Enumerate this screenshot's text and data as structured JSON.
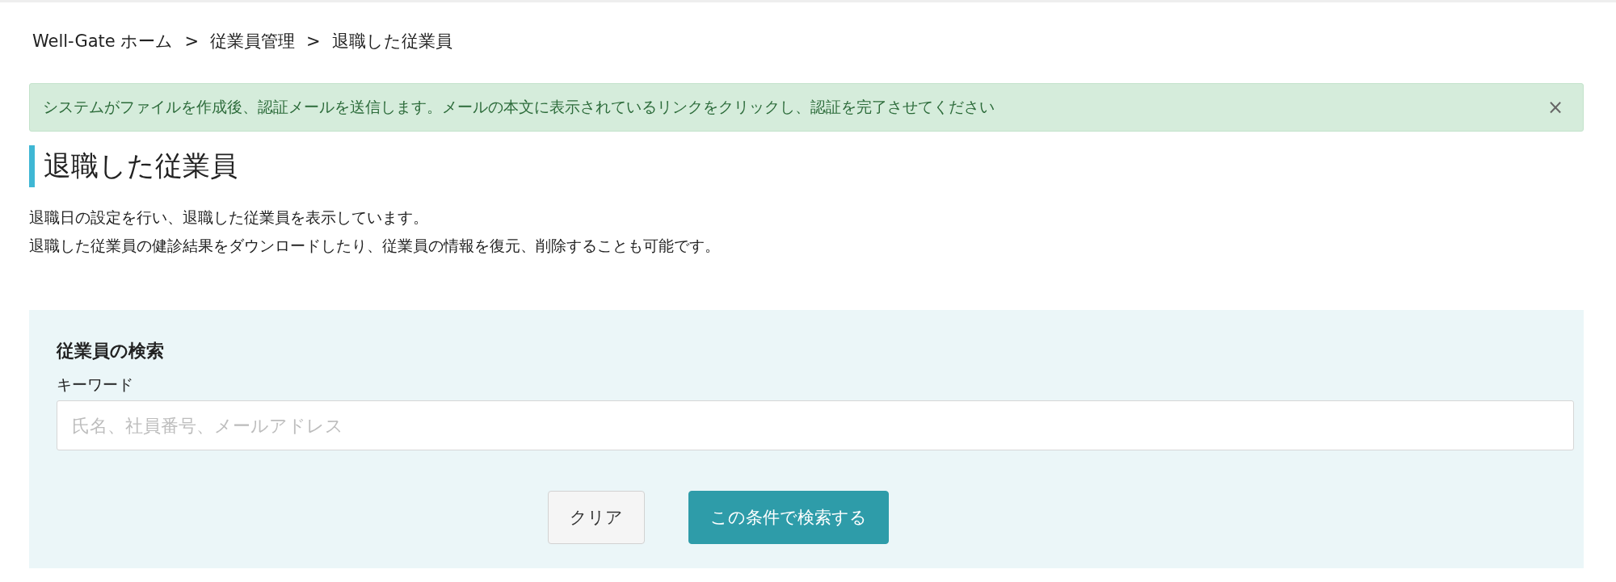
{
  "breadcrumb": [
    {
      "label": "Well-Gate ホーム",
      "separator": ">"
    },
    {
      "label": "従業員管理",
      "separator": ">"
    },
    {
      "label": "退職した従業員"
    }
  ],
  "alert": {
    "message": "システムがファイルを作成後、認証メールを送信します。メールの本文に表示されているリンクをクリックし、認証を完了させてください",
    "close": "×"
  },
  "page_title": "退職した従業員",
  "description": [
    "退職日の設定を行い、退職した従業員を表示しています。",
    "退職した従業員の健診結果をダウンロードしたり、従業員の情報を復元、削除することも可能です。"
  ],
  "search_panel": {
    "heading": "従業員の検索",
    "field_label": "キーワード",
    "placeholder": "氏名、社員番号、メールアドレス",
    "buttons": [
      {
        "kind": "secondary",
        "label": "クリア"
      },
      {
        "kind": "primary",
        "label": "この条件で検索する"
      }
    ]
  }
}
